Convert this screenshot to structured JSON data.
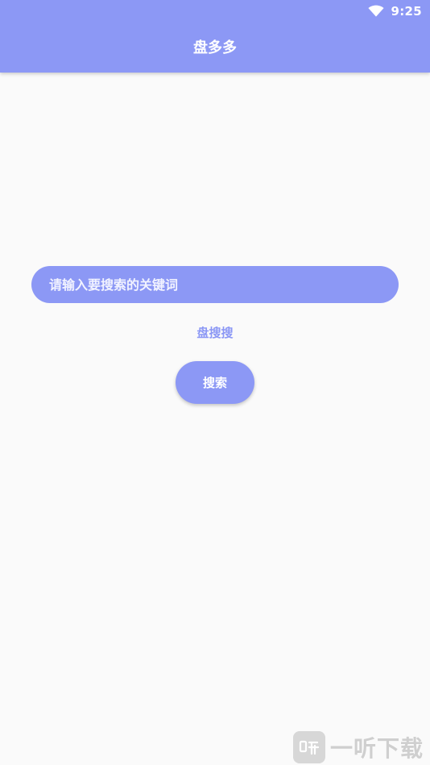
{
  "status_bar": {
    "time": "9:25",
    "wifi_icon": "wifi-icon"
  },
  "app_bar": {
    "title": "盘多多"
  },
  "search": {
    "placeholder": "请输入要搜索的关键词",
    "value": ""
  },
  "source_label": "盘搜搜",
  "search_button": {
    "label": "搜索"
  },
  "watermark": {
    "text": "一听下载"
  },
  "colors": {
    "primary": "#8c98f5",
    "background": "#fafafa",
    "text_on_primary": "#ffffff",
    "watermark": "#cfcfcf"
  }
}
